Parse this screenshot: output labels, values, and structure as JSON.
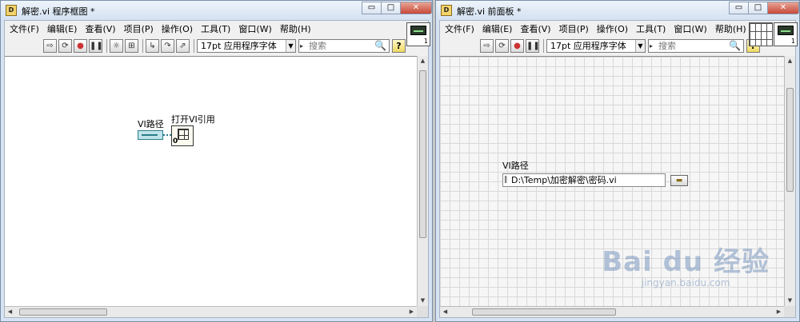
{
  "left_window": {
    "title": "解密.vi 程序框图 *",
    "app_icon_glyph": "D",
    "menu": [
      "文件(F)",
      "编辑(E)",
      "查看(V)",
      "项目(P)",
      "操作(O)",
      "工具(T)",
      "窗口(W)",
      "帮助(H)"
    ],
    "toolbar": {
      "font_selector": "17pt 应用程序字体",
      "search_placeholder": "搜索"
    },
    "vi_icon_number": "1",
    "diagram": {
      "path_terminal_label": "VI路径",
      "open_ref_label": "打开VI引用",
      "open_ref_zero": "0"
    }
  },
  "right_window": {
    "title": "解密.vi 前面板 *",
    "app_icon_glyph": "D",
    "menu": [
      "文件(F)",
      "编辑(E)",
      "查看(V)",
      "项目(P)",
      "操作(O)",
      "工具(T)",
      "窗口(W)",
      "帮助(H)"
    ],
    "toolbar": {
      "font_selector": "17pt 应用程序字体",
      "search_placeholder": "搜索"
    },
    "vi_icon_number": "1",
    "front_panel": {
      "path_label": "VI路径",
      "path_value": "D:\\Temp\\加密解密\\密码.vi"
    }
  },
  "window_controls": {
    "minimize": "▭",
    "maximize": "□",
    "close": "✕"
  },
  "watermark": {
    "logo": "Bai du 经验",
    "url": "jingyan.baidu.com"
  }
}
